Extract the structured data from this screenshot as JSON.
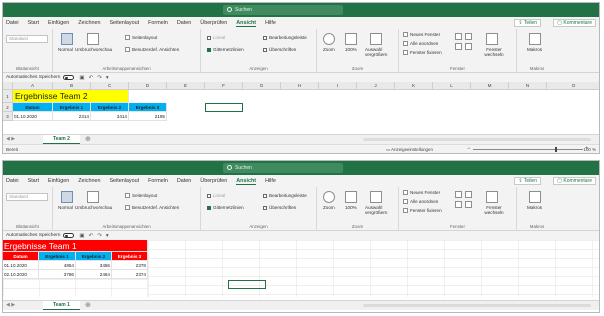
{
  "windows": [
    {
      "id": "A",
      "filename": "team2.xlsx",
      "search_placeholder": "Suchen",
      "tabs": [
        "Datei",
        "Start",
        "Einfügen",
        "Zeichnen",
        "Seitenlayout",
        "Formeln",
        "Daten",
        "Überprüfen",
        "Ansicht",
        "Hilfe"
      ],
      "active_tab": "Ansicht",
      "share": "Teilen",
      "comments": "Kommentare",
      "ribbon": {
        "sheetview_dropdown": "Standard",
        "sheetview_group": "Blattansicht",
        "normal": "Normal",
        "pagebreak": "Umbruchvorschau",
        "pagelayout": "Seitenlayout",
        "custom_views": "Benutzerdef. Ansichten",
        "workbook_views_group": "Arbeitsmappenansichten",
        "ruler": "Lineal",
        "gridlines": "Gitternetzlinien",
        "formula_bar": "Bearbeitungsleiste",
        "headings": "Überschriften",
        "show_group": "Anzeigen",
        "zoom": "Zoom",
        "zoom100": "100%",
        "zoom_selection": "Auswahl vergrößern",
        "zoom_group": "Zoom",
        "new_window": "Neues Fenster",
        "arrange_all": "Alle anordnen",
        "freeze_panes": "Fenster fixieren",
        "switch_windows": "Fenster wechseln",
        "window_group": "Fenster",
        "macros": "Makros",
        "macros_group": "Makros"
      },
      "autosave_label": "Automatisches Speichern",
      "namebox": "",
      "columns": [
        "A",
        "B",
        "C",
        "D",
        "E",
        "F",
        "G",
        "H",
        "I",
        "J",
        "K",
        "L",
        "M",
        "N",
        "O"
      ],
      "title_cell": "Ergebnisse Team 2",
      "headers": [
        "Datum",
        "Ergebnis 1",
        "Ergebnis 2",
        "Ergebnis 3"
      ],
      "rows": [
        [
          "01.10.2020",
          "2314",
          "3414",
          "2195"
        ]
      ],
      "sheet_tab": "Team 2",
      "status_left": "Bereit",
      "display_settings": "Anzeigeeinstellungen",
      "zoom_pct": "100 %"
    },
    {
      "id": "B",
      "filename": "team1.xlsx",
      "search_placeholder": "Suchen",
      "tabs": [
        "Datei",
        "Start",
        "Einfügen",
        "Zeichnen",
        "Seitenlayout",
        "Formeln",
        "Daten",
        "Überprüfen",
        "Ansicht",
        "Hilfe"
      ],
      "active_tab": "Ansicht",
      "share": "Teilen",
      "comments": "Kommentare",
      "ribbon": {
        "sheetview_dropdown": "Standard",
        "sheetview_group": "Blattansicht",
        "normal": "Normal",
        "pagebreak": "Umbruchvorschau",
        "pagelayout": "Seitenlayout",
        "custom_views": "Benutzerdef. Ansichten",
        "workbook_views_group": "Arbeitsmappenansichten",
        "ruler": "Lineal",
        "gridlines": "Gitternetzlinien",
        "formula_bar": "Bearbeitungsleiste",
        "headings": "Überschriften",
        "show_group": "Anzeigen",
        "zoom": "Zoom",
        "zoom100": "100%",
        "zoom_selection": "Auswahl vergrößern",
        "zoom_group": "Zoom",
        "new_window": "Neues Fenster",
        "arrange_all": "Alle anordnen",
        "freeze_panes": "Fenster fixieren",
        "switch_windows": "Fenster wechseln",
        "window_group": "Fenster",
        "macros": "Makros",
        "macros_group": "Makros"
      },
      "autosave_label": "Automatisches Speichern",
      "namebox": "",
      "title_cell": "Ergebnisse Team 1",
      "headers": [
        "Datum",
        "Ergebnis 1",
        "Ergebnis 2",
        "Ergebnis 3"
      ],
      "rows": [
        [
          "01.10.2020",
          "4854",
          "3456",
          "2378"
        ],
        [
          "02.10.2020",
          "3786",
          "2464",
          "2374"
        ]
      ],
      "sheet_tab": "Team 1"
    }
  ],
  "colors": {
    "excel_green": "#217346",
    "yellow_fill": "#ffff00",
    "cyan_fill": "#00b0f0",
    "red_fill": "#ff0000"
  }
}
